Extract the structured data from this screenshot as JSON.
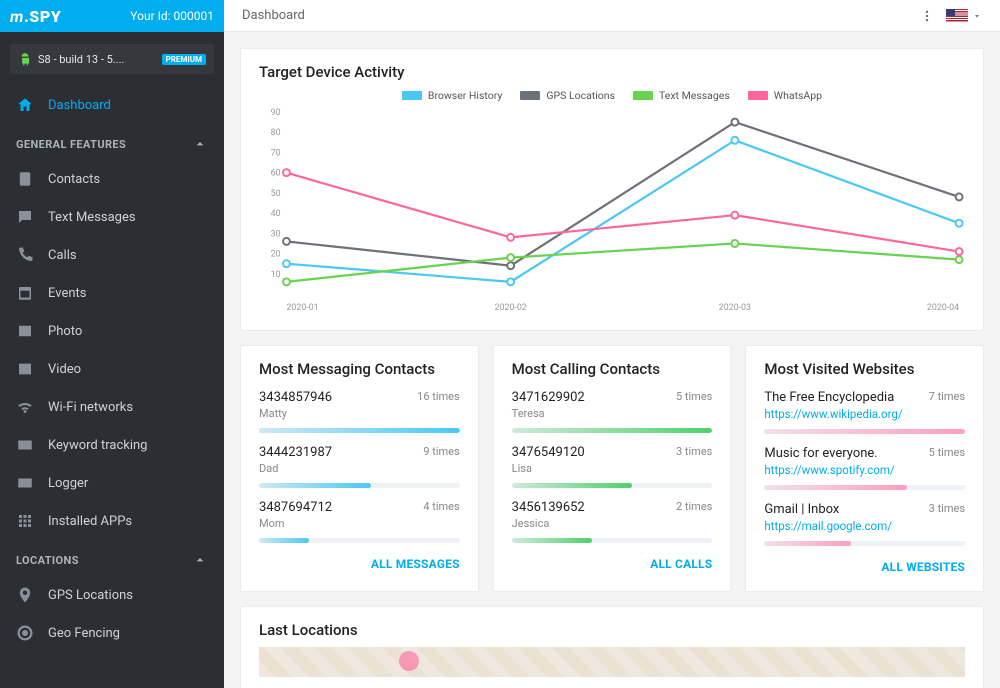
{
  "header": {
    "logo_text": "mSPY",
    "user_id_label": "Your Id: 000001",
    "page_title": "Dashboard"
  },
  "device": {
    "name": "S8 - build 13 - 5....",
    "badge": "PREMIUM"
  },
  "nav": {
    "dashboard": "Dashboard",
    "section_general": "GENERAL FEATURES",
    "contacts": "Contacts",
    "texts": "Text Messages",
    "calls": "Calls",
    "events": "Events",
    "photo": "Photo",
    "video": "Video",
    "wifi": "Wi-Fi networks",
    "keyword": "Keyword tracking",
    "logger": "Logger",
    "apps": "Installed APPs",
    "section_locations": "LOCATIONS",
    "gps": "GPS Locations",
    "geofence": "Geo Fencing"
  },
  "chart_title": "Target Device Activity",
  "chart_data": {
    "type": "line",
    "categories": [
      "2020-01",
      "2020-02",
      "2020-03",
      "2020-04"
    ],
    "ylim": [
      0,
      90
    ],
    "yticks": [
      10,
      20,
      30,
      40,
      50,
      60,
      70,
      80,
      90
    ],
    "legend_position": "top",
    "series": [
      {
        "name": "Browser History",
        "color": "#49c8f5",
        "values": [
          15,
          6,
          76,
          35
        ]
      },
      {
        "name": "GPS Locations",
        "color": "#6d7278",
        "values": [
          26,
          14,
          85,
          48
        ]
      },
      {
        "name": "Text Messages",
        "color": "#67d34e",
        "values": [
          6,
          18,
          25,
          17
        ]
      },
      {
        "name": "WhatsApp",
        "color": "#ff669d",
        "values": [
          60,
          28,
          39,
          21
        ]
      }
    ]
  },
  "legend": {
    "0": "Browser History",
    "1": "GPS Locations",
    "2": "Text Messages",
    "3": "WhatsApp"
  },
  "panel_msg": {
    "title": "Most Messaging Contacts",
    "link": "ALL MESSAGES",
    "color": "#49c8f5",
    "items": [
      {
        "num": "3434857946",
        "name": "Matty",
        "count": "16 times",
        "pct": 100
      },
      {
        "num": "3444231987",
        "name": "Dad",
        "count": "9 times",
        "pct": 56
      },
      {
        "num": "3487694712",
        "name": "Mom",
        "count": "4 times",
        "pct": 25
      }
    ]
  },
  "panel_call": {
    "title": "Most Calling Contacts",
    "link": "ALL CALLS",
    "color": "#4fd06b",
    "items": [
      {
        "num": "3471629902",
        "name": "Teresa",
        "count": "5 times",
        "pct": 100
      },
      {
        "num": "3476549120",
        "name": "Lisa",
        "count": "3 times",
        "pct": 60
      },
      {
        "num": "3456139652",
        "name": "Jessica",
        "count": "2 times",
        "pct": 40
      }
    ]
  },
  "panel_web": {
    "title": "Most Visited Websites",
    "link": "ALL WEBSITES",
    "color": "#ff9ec2",
    "items": [
      {
        "num": "The Free Encyclopedia",
        "name": "https://www.wikipedia.org/",
        "count": "7 times",
        "pct": 100
      },
      {
        "num": "Music for everyone.",
        "name": "https://www.spotify.com/",
        "count": "5 times",
        "pct": 71
      },
      {
        "num": "Gmail | Inbox",
        "name": "https://mail.google.com/",
        "count": "3 times",
        "pct": 43
      }
    ]
  },
  "last_locations_title": "Last Locations"
}
